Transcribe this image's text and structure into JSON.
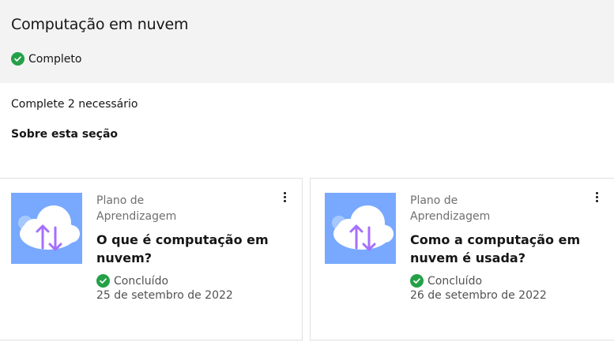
{
  "header": {
    "title": "Computação em nuvem",
    "status": "Completo",
    "status_icon": "checkmark-filled-icon",
    "status_color": "#24a148",
    "background": "#f3f3f3"
  },
  "section": {
    "requirement": "Complete 2 necessário",
    "about_label": "Sobre esta seção"
  },
  "cards": [
    {
      "type_line1": "Plano de",
      "type_line2": "Aprendizagem",
      "title_line1": "O que é computação em",
      "title_line2": "nuvem?",
      "status": "Concluído",
      "date": "25 de setembro de 2022",
      "thumbnail_icon": "cloud-transfer-icon",
      "menu_icon": "overflow-menu-icon"
    },
    {
      "type_line1": "Plano de",
      "type_line2": "Aprendizagem",
      "title_line1": "Como a computação em",
      "title_line2": "nuvem é usada?",
      "status": "Concluído",
      "date": "26 de setembro de 2022",
      "thumbnail_icon": "cloud-transfer-icon",
      "menu_icon": "overflow-menu-icon"
    }
  ],
  "colors": {
    "thumbnail_bg": "#78a9ff",
    "arrow_color": "#a56eff",
    "cloud_light": "#ffffff",
    "cloud_shade": "#a6c8ff"
  }
}
